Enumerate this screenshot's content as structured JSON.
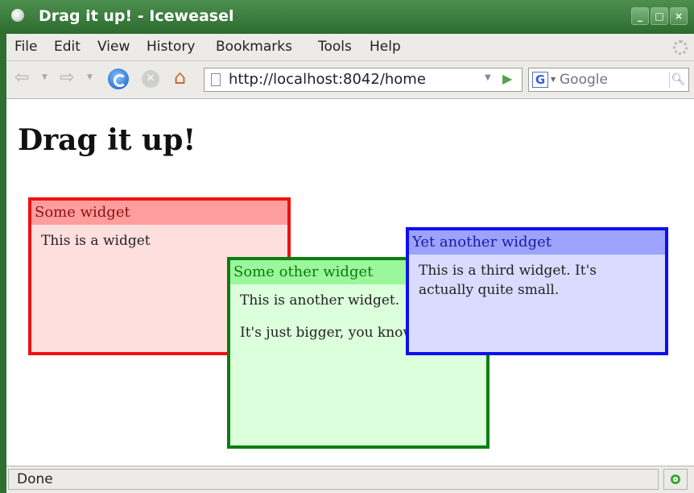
{
  "window": {
    "title": "Drag it up! - Iceweasel",
    "controls": {
      "minimize": "_",
      "maximize": "□",
      "close": "×"
    }
  },
  "menubar": {
    "items": [
      "File",
      "Edit",
      "View",
      "History",
      "Bookmarks",
      "Tools",
      "Help"
    ]
  },
  "navbar": {
    "back_icon": "back-arrow-icon",
    "forward_icon": "forward-arrow-icon",
    "reload_icon": "reload-icon",
    "stop_icon": "stop-icon",
    "home_icon": "home-icon",
    "url": "http://localhost:8042/home",
    "search": {
      "engine": "G",
      "placeholder": "Google"
    }
  },
  "page": {
    "heading": "Drag it up!",
    "widgets": [
      {
        "title": "Some widget",
        "paragraphs": [
          "This is a widget"
        ],
        "border": "#ee1111",
        "header_bg": "#ff9d9d",
        "body_bg": "#ffdede"
      },
      {
        "title": "Some other widget",
        "paragraphs": [
          "This is another widget.",
          "It's just bigger, you know."
        ],
        "border": "#0a7e10",
        "header_bg": "#9bf79b",
        "body_bg": "#dcffdc"
      },
      {
        "title": "Yet another widget",
        "paragraphs": [
          "This is a third widget. It's actually quite small."
        ],
        "border": "#0c10ef",
        "header_bg": "#9da2fc",
        "body_bg": "#d9dcfe"
      }
    ]
  },
  "statusbar": {
    "text": "Done"
  },
  "colors": {
    "titlebar": "#3d7d3f",
    "chrome": "#ecebe7"
  }
}
